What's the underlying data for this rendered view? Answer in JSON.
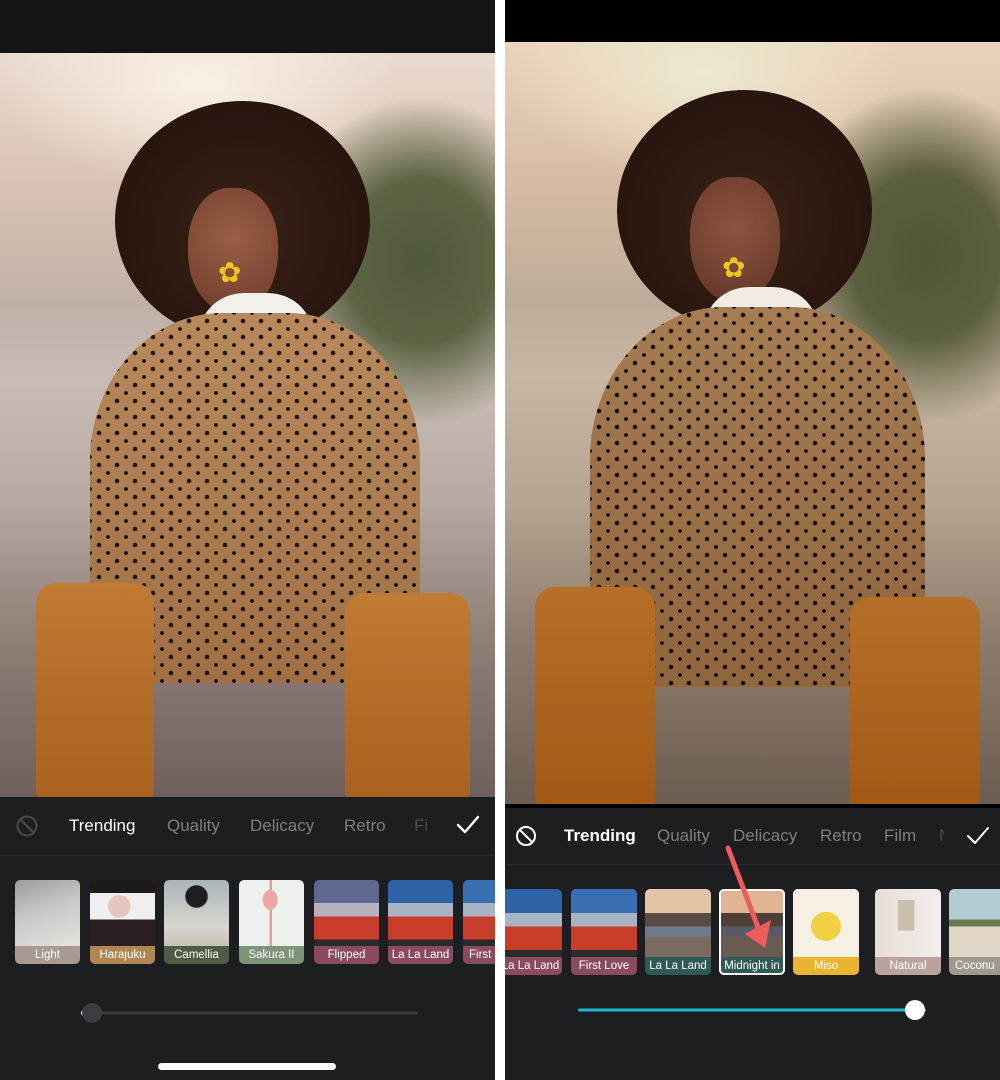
{
  "left_screen": {
    "categories": [
      "Trending",
      "Quality",
      "Delicacy",
      "Retro",
      "Fi"
    ],
    "active_category": "Trending",
    "filters": [
      {
        "label": "Light",
        "color": "#a89a90"
      },
      {
        "label": "Harajuku",
        "color": "#b08653"
      },
      {
        "label": "Camellia",
        "color": "#4e5c46"
      },
      {
        "label": "Sakura II",
        "color": "#7d9479"
      },
      {
        "label": "Flipped",
        "color": "#8a4b5e"
      },
      {
        "label": "La La Land",
        "color": "#8a4b5e"
      },
      {
        "label": "First",
        "color": "#8a4b5e"
      }
    ],
    "intensity": 0,
    "track_color": "#3a3b40",
    "knob_color": "#3c3d42"
  },
  "right_screen": {
    "categories": [
      "Trending",
      "Quality",
      "Delicacy",
      "Retro",
      "Film",
      "N"
    ],
    "active_category": "Trending",
    "filters": [
      {
        "label": "La La Land",
        "color": "#8a4b5e"
      },
      {
        "label": "First Love",
        "color": "#8a4b5e"
      },
      {
        "label": "La La Land",
        "color": "#2f5a55"
      },
      {
        "label": "Midnight in",
        "color": "#2f5a55",
        "selected": true
      },
      {
        "label": "Miso",
        "color": "#e9b52f"
      },
      {
        "label": "Natural",
        "color": "#b9a39c"
      },
      {
        "label": "Coconu",
        "color": "#9e9a90"
      }
    ],
    "intensity": 100,
    "track_color": "#1fb6cf",
    "knob_color": "#ffffff",
    "annotation_arrow_color": "#ee5b5b"
  },
  "icons": {
    "none": "no-filter-icon",
    "confirm": "checkmark-icon"
  }
}
